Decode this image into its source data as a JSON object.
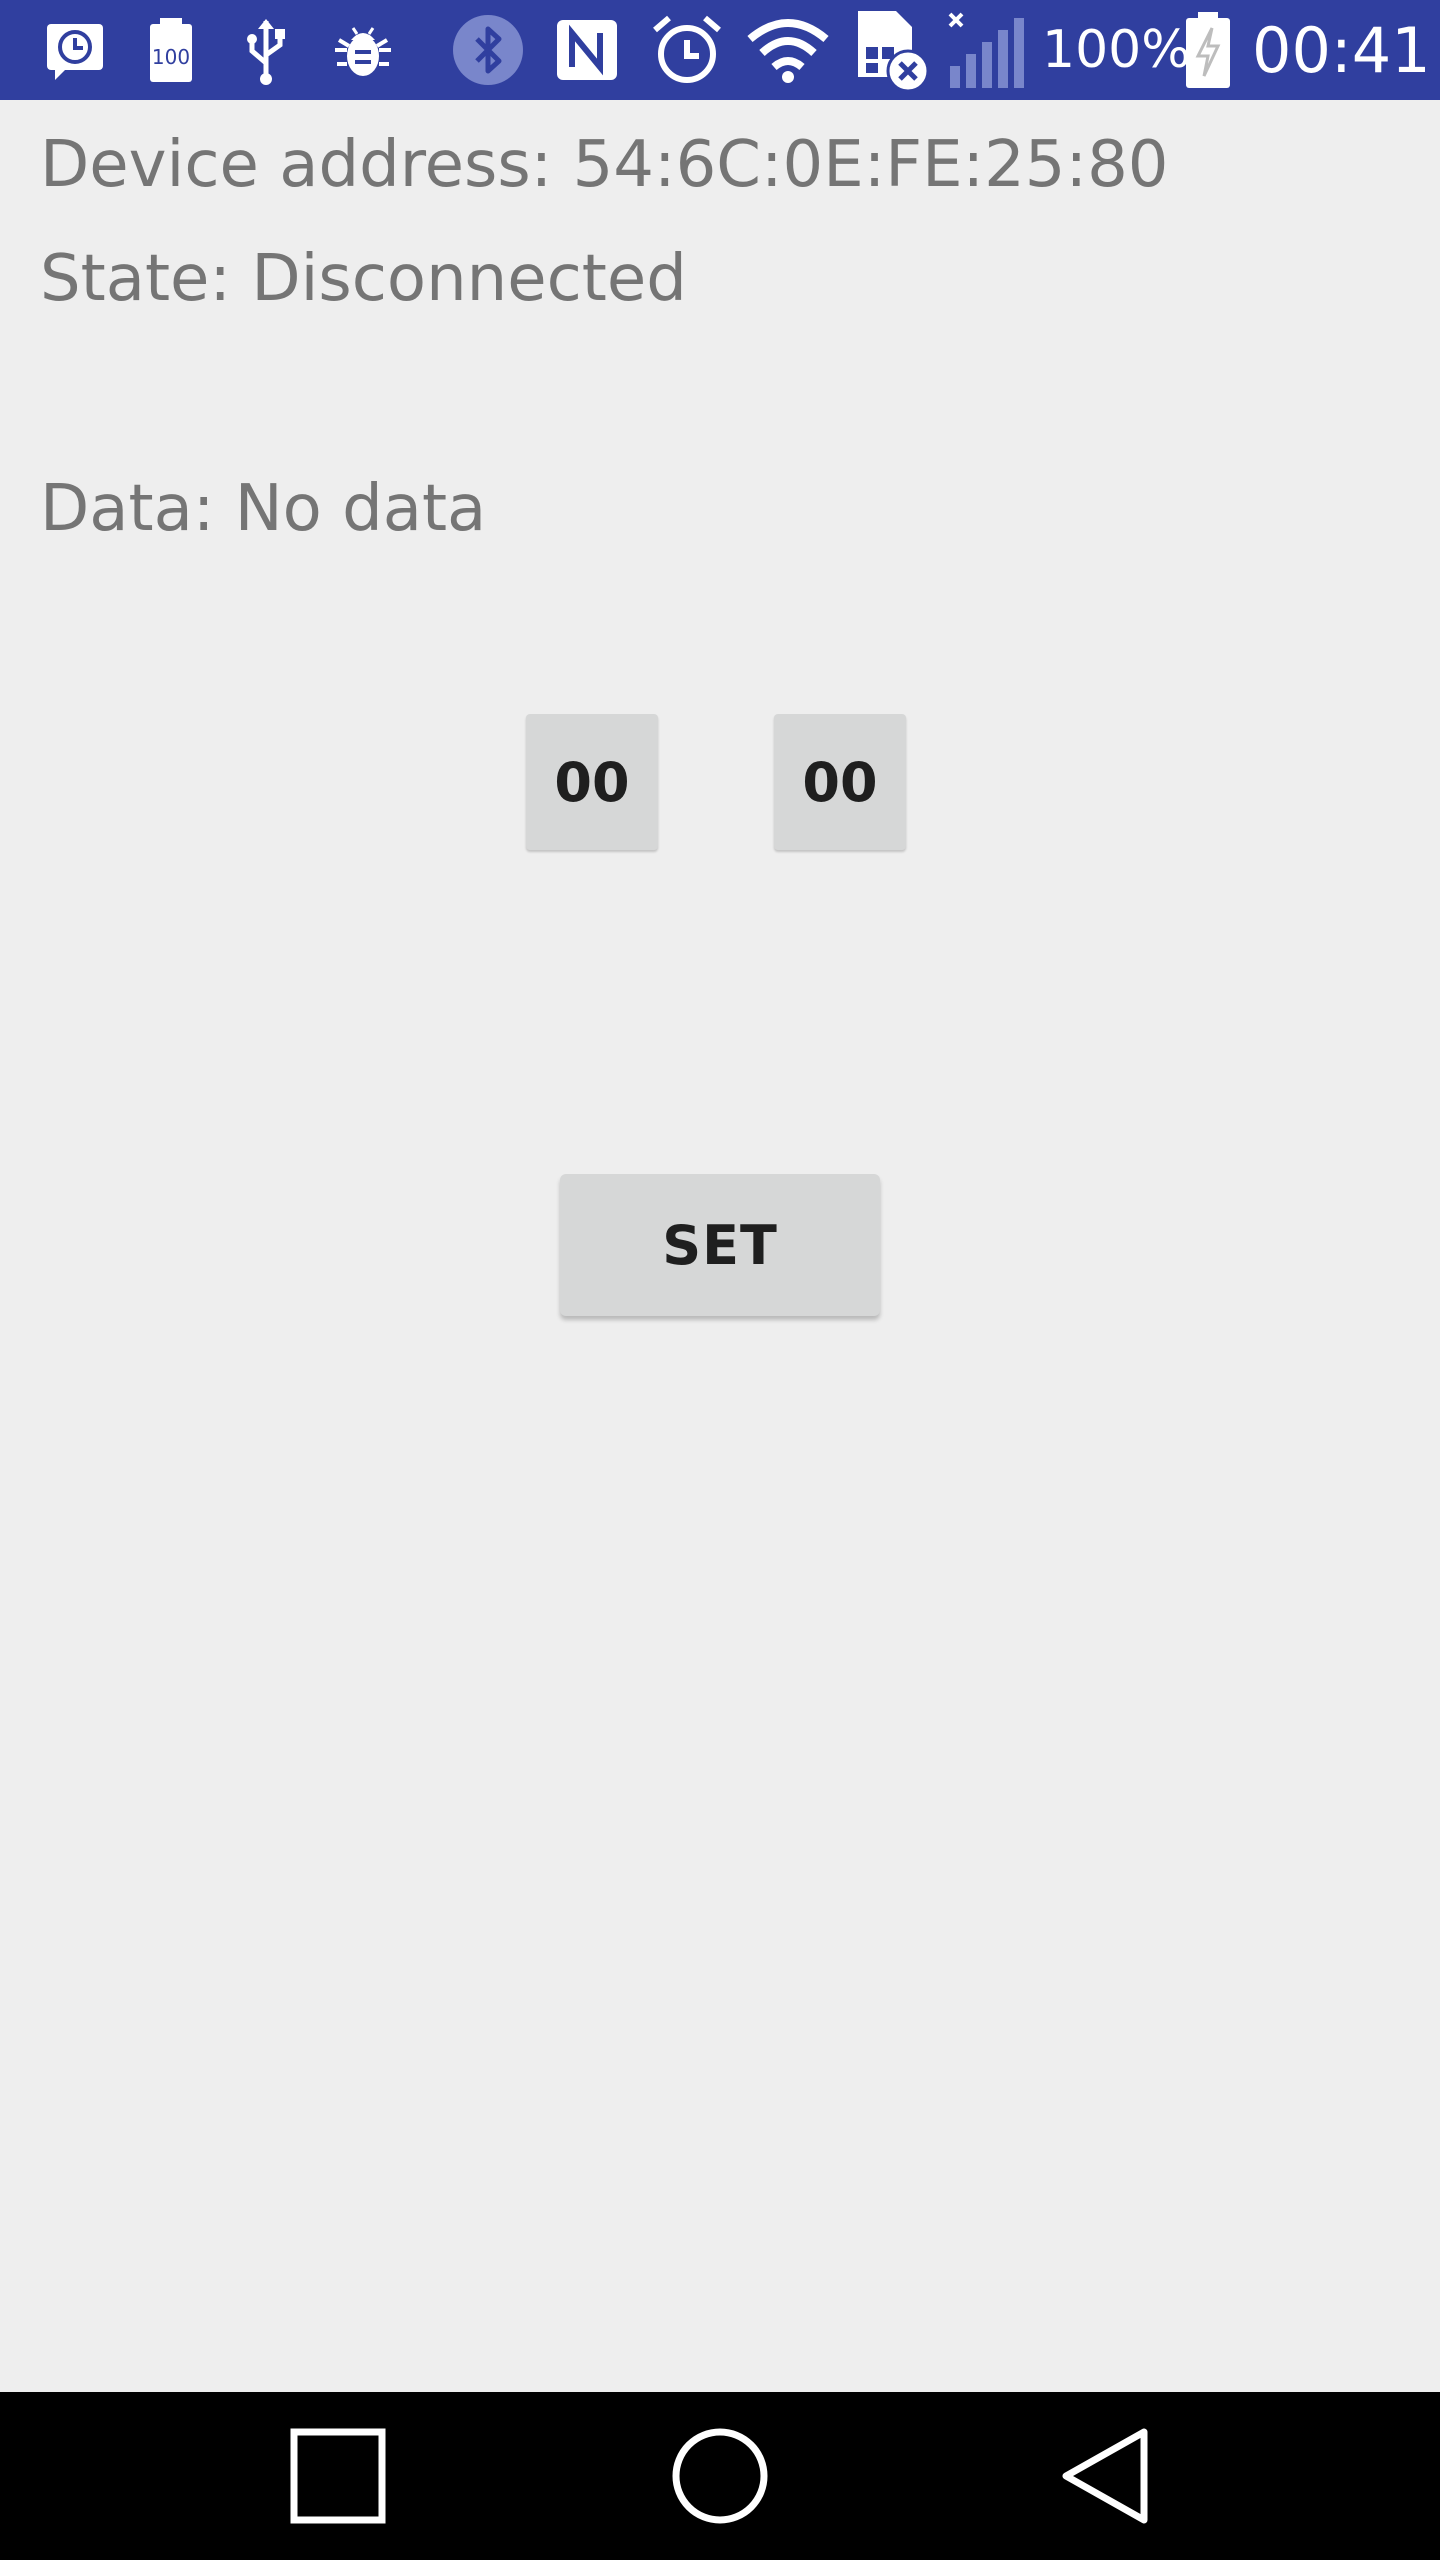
{
  "status_bar": {
    "icons": [
      "screen-clock-icon",
      "battery-100-icon",
      "usb-icon",
      "bug-icon",
      "bluetooth-icon",
      "nfc-icon",
      "alarm-icon",
      "wifi-icon",
      "sim-missing-icon",
      "cell-signal-icon",
      "battery-charging-icon"
    ],
    "battery_text": "100%",
    "time": "00:41",
    "mini_battery_text": "100",
    "color": "#303f9f"
  },
  "device": {
    "address_label": "Device address: 54:6C:0E:FE:25:80",
    "state_label": "State: Disconnected",
    "data_label": "Data: No data"
  },
  "controls": {
    "hours_value": "00",
    "minutes_value": "00",
    "set_label": "SET"
  },
  "nav_bar": {
    "items": [
      "recents-icon",
      "home-icon",
      "back-icon"
    ]
  }
}
